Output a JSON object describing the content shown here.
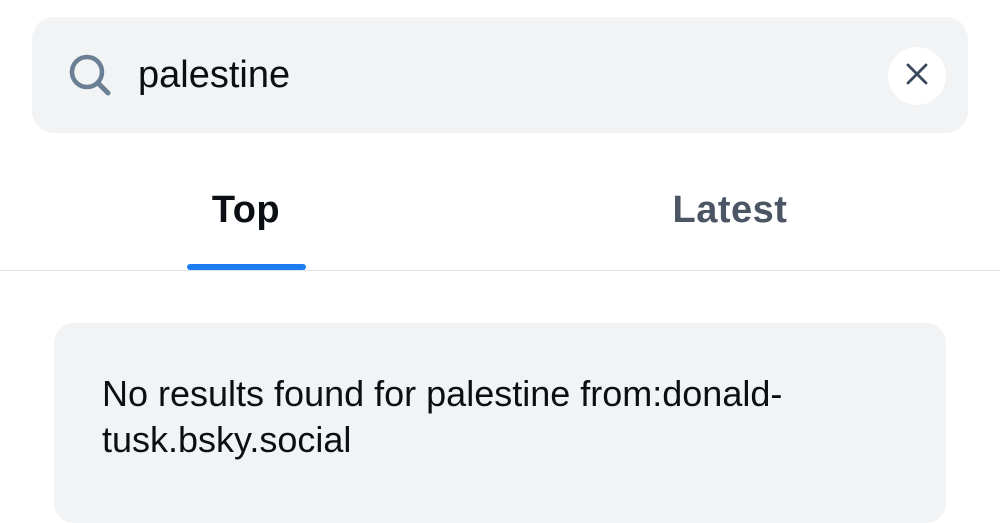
{
  "search": {
    "value": "palestine",
    "icon": "search-icon",
    "clear_icon": "close-icon"
  },
  "tabs": [
    {
      "label": "Top",
      "active": true
    },
    {
      "label": "Latest",
      "active": false
    }
  ],
  "results": {
    "message": "No results found for palestine from:donald-tusk.bsky.social"
  },
  "colors": {
    "accent": "#1d7df2",
    "surface": "#f1f3f5",
    "text_primary": "#0b0f14",
    "text_secondary": "#4b5563",
    "icon": "#6b7f94"
  }
}
